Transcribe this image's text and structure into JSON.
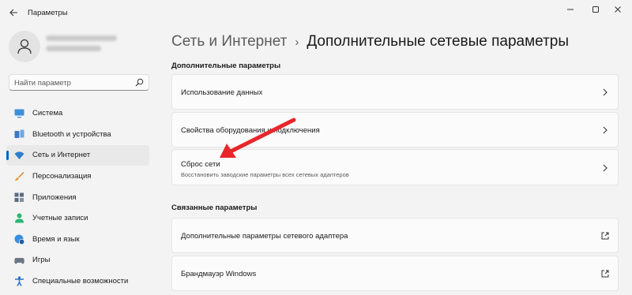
{
  "window": {
    "title": "Параметры",
    "controls": [
      "minimize-icon",
      "maximize-icon",
      "close-icon"
    ]
  },
  "search": {
    "placeholder": "Найти параметр"
  },
  "sidebar": {
    "items": [
      {
        "label": "Система",
        "icon": "monitor-icon",
        "active": false
      },
      {
        "label": "Bluetooth и устройства",
        "icon": "bluetooth-icon",
        "active": false
      },
      {
        "label": "Сеть и Интернет",
        "icon": "wifi-icon",
        "active": true
      },
      {
        "label": "Персонализация",
        "icon": "brush-icon",
        "active": false
      },
      {
        "label": "Приложения",
        "icon": "apps-icon",
        "active": false
      },
      {
        "label": "Учетные записи",
        "icon": "person-icon",
        "active": false
      },
      {
        "label": "Время и язык",
        "icon": "globe-clock-icon",
        "active": false
      },
      {
        "label": "Игры",
        "icon": "gamepad-icon",
        "active": false
      },
      {
        "label": "Специальные возможности",
        "icon": "accessibility-icon",
        "active": false
      }
    ]
  },
  "breadcrumb": {
    "parent": "Сеть и Интернет",
    "separator": "›",
    "current": "Дополнительные сетевые параметры"
  },
  "sections": {
    "advanced": {
      "title": "Дополнительные параметры",
      "items": [
        {
          "title": "Использование данных",
          "description": ""
        },
        {
          "title": "Свойства оборудования и подключения",
          "description": ""
        },
        {
          "title": "Сброс сети",
          "description": "Восстановить заводские параметры всех сетевых адаптеров"
        }
      ]
    },
    "related": {
      "title": "Связанные параметры",
      "items": [
        {
          "title": "Дополнительные параметры сетевого адаптера"
        },
        {
          "title": "Брандмауэр Windows"
        }
      ]
    }
  },
  "colors": {
    "accent": "#0067c0",
    "annotation_arrow": "#e8262a",
    "background": "#f3f3f3",
    "card": "#fbfbfb"
  }
}
